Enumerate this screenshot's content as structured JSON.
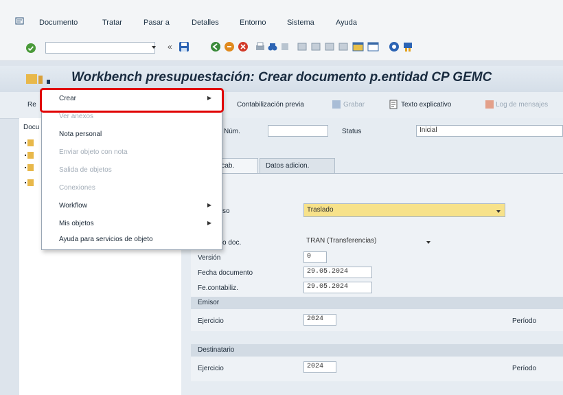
{
  "menu": {
    "items": [
      "Documento",
      "Tratar",
      "Pasar a",
      "Detalles",
      "Entorno",
      "Sistema",
      "Ayuda"
    ]
  },
  "title": "Workbench presupuestación: Crear documento p.entidad CP GEMC",
  "app_toolbar": {
    "left_cut": "Re",
    "preview": "Contabilización previa",
    "save": "Grabar",
    "text": "Texto explicativo",
    "log": "Log de mensajes"
  },
  "left_panel": {
    "header_cut": "Docu"
  },
  "header_fields": {
    "docnum_label": "Núm.",
    "status_label": "Status",
    "status_value": "Inicial"
  },
  "tabs": [
    "os cab.",
    "Datos adicion."
  ],
  "form": {
    "proceso_label": "so",
    "proceso_value": "Traslado",
    "tipo_label": "o doc.",
    "tipo_value": "TRAN (Transferencias)",
    "version_label": "Versión",
    "version_value": "0",
    "fecha_label": "Fecha documento",
    "fecha_value": "29.05.2024",
    "fecont_label": "Fe.contabiliz.",
    "fecont_value": "29.05.2024"
  },
  "sender": {
    "title": "Emisor",
    "ejercicio_label": "Ejercicio",
    "ejercicio_value": "2024",
    "periodo_label": "Período"
  },
  "receiver": {
    "title": "Destinatario",
    "ejercicio_label": "Ejercicio",
    "ejercicio_value": "2024",
    "periodo_label": "Período"
  },
  "context_menu": {
    "items": [
      {
        "label": "Crear",
        "disabled": false,
        "submenu": true
      },
      {
        "label": "Ver anexos",
        "disabled": true,
        "submenu": false
      },
      {
        "label": "Nota personal",
        "disabled": false,
        "submenu": false
      },
      {
        "label": "Enviar objeto con nota",
        "disabled": true,
        "submenu": false
      },
      {
        "label": "Salida de objetos",
        "disabled": true,
        "submenu": false
      },
      {
        "label": "Conexiones",
        "disabled": true,
        "submenu": false
      },
      {
        "label": "Workflow",
        "disabled": false,
        "submenu": true
      },
      {
        "label": "Mis objetos",
        "disabled": false,
        "submenu": true
      },
      {
        "label": "Ayuda para servicios de objeto",
        "disabled": false,
        "submenu": false
      }
    ]
  },
  "colors": {
    "highlight": "#e00000",
    "title_bar": "#d5dee8",
    "dropdown_yellow": "#f7e28a"
  }
}
